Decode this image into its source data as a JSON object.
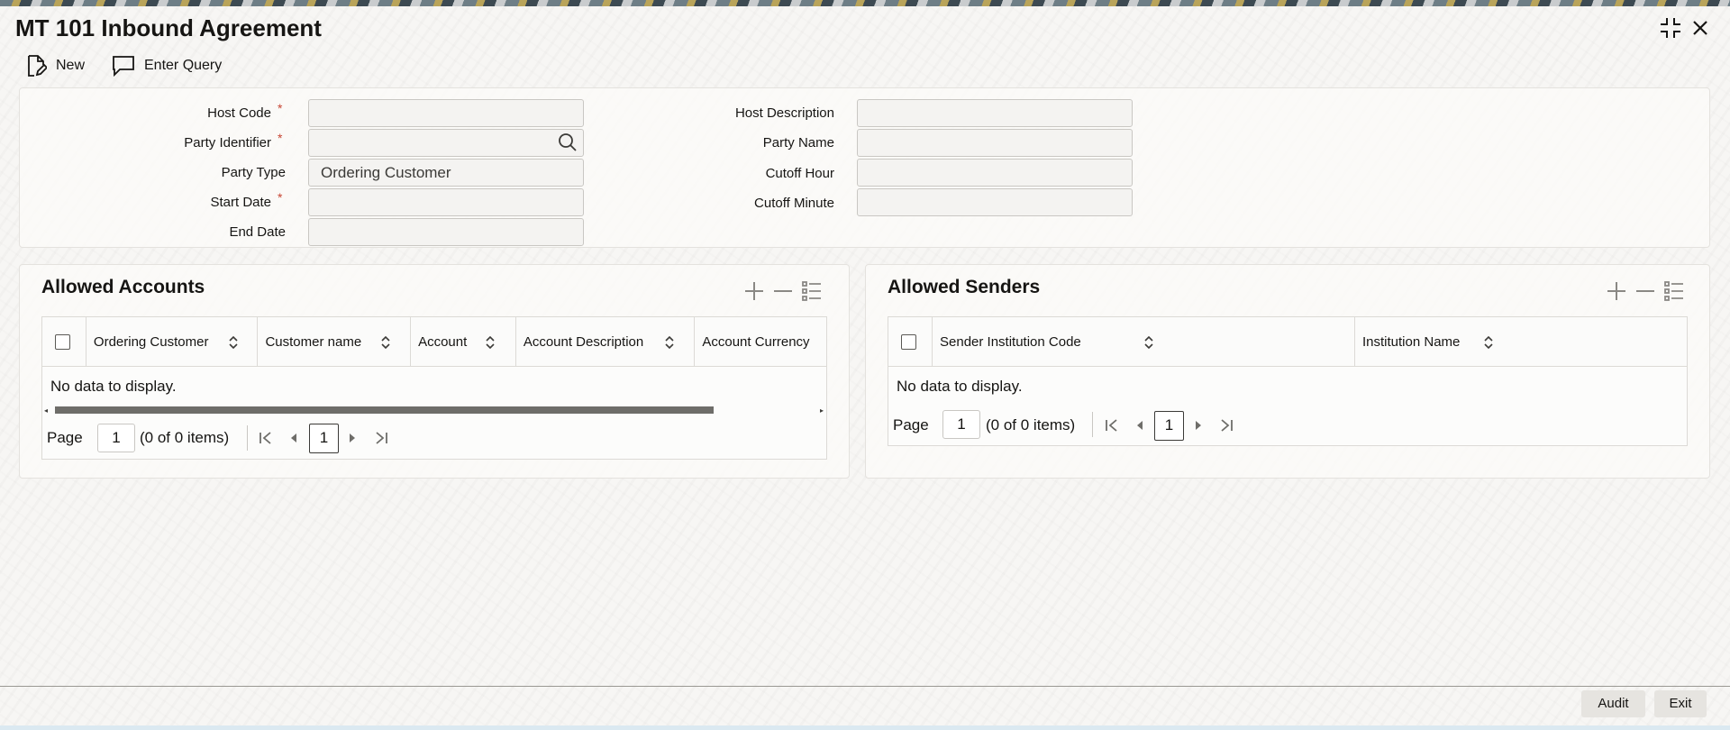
{
  "window": {
    "title": "MT 101 Inbound Agreement",
    "controls": {
      "minimize_icon": "collapse-icon",
      "close_icon": "close-icon"
    }
  },
  "toolbar": {
    "new_label": "New",
    "enter_query_label": "Enter Query"
  },
  "form": {
    "host_code_label": "Host Code",
    "host_code_value": "",
    "party_identifier_label": "Party Identifier",
    "party_identifier_value": "",
    "party_type_label": "Party Type",
    "party_type_value": "Ordering Customer",
    "start_date_label": "Start Date",
    "start_date_value": "",
    "end_date_label": "End Date",
    "end_date_value": "",
    "host_description_label": "Host Description",
    "party_name_label": "Party Name",
    "cutoff_hour_label": "Cutoff Hour",
    "cutoff_minute_label": "Cutoff Minute",
    "required_mark": "*"
  },
  "allowed_accounts": {
    "title": "Allowed Accounts",
    "columns": [
      "Ordering Customer",
      "Customer name",
      "Account",
      "Account Description",
      "Account Currency"
    ],
    "empty_text": "No data to display.",
    "page_label": "Page",
    "page_value": "1",
    "items_text": "(0 of 0 items)",
    "current_page": "1"
  },
  "allowed_senders": {
    "title": "Allowed Senders",
    "columns": [
      "Sender Institution Code",
      "Institution Name"
    ],
    "empty_text": "No data to display.",
    "page_label": "Page",
    "page_value": "1",
    "items_text": "(0 of 0 items)",
    "current_page": "1"
  },
  "footer": {
    "audit_label": "Audit",
    "exit_label": "Exit"
  },
  "colors": {
    "required": "#c74634",
    "text": "#161513"
  }
}
